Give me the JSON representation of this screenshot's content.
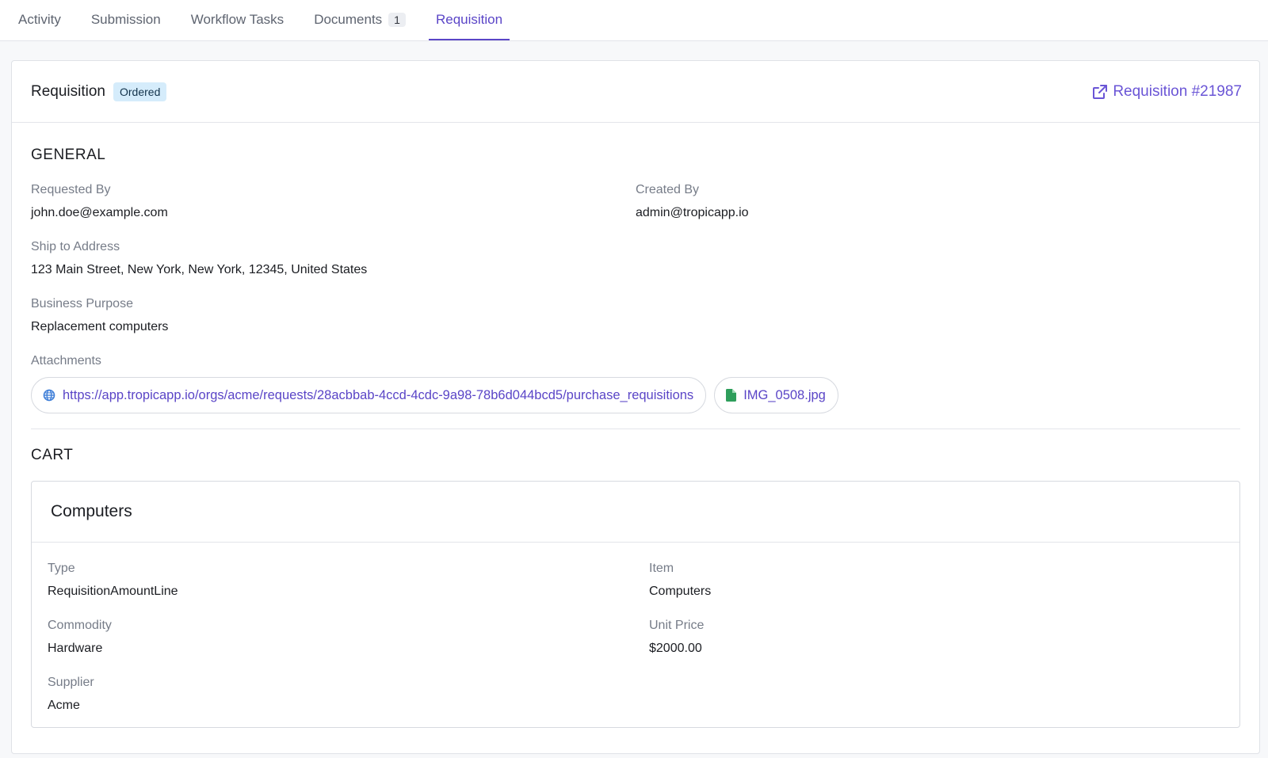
{
  "tabs": [
    {
      "label": "Activity"
    },
    {
      "label": "Submission"
    },
    {
      "label": "Workflow Tasks"
    },
    {
      "label": "Documents",
      "badge": "1"
    },
    {
      "label": "Requisition",
      "active": true
    }
  ],
  "header": {
    "title": "Requisition",
    "status": "Ordered",
    "link_label": "Requisition #21987"
  },
  "general": {
    "title": "GENERAL",
    "requested_by": {
      "label": "Requested By",
      "value": "john.doe@example.com"
    },
    "created_by": {
      "label": "Created By",
      "value": "admin@tropicapp.io"
    },
    "ship_to": {
      "label": "Ship to Address",
      "value": "123 Main Street, New York, New York, 12345, United States"
    },
    "purpose": {
      "label": "Business Purpose",
      "value": "Replacement computers"
    },
    "attachments": {
      "label": "Attachments",
      "items": [
        {
          "label": "https://app.tropicapp.io/orgs/acme/requests/28acbbab-4ccd-4cdc-9a98-78b6d044bcd5/purchase_requisitions",
          "icon": "globe-icon"
        },
        {
          "label": "IMG_0508.jpg",
          "icon": "file-icon"
        }
      ]
    }
  },
  "cart": {
    "title": "CART",
    "item": {
      "name": "Computers",
      "type": {
        "label": "Type",
        "value": "RequisitionAmountLine"
      },
      "item": {
        "label": "Item",
        "value": "Computers"
      },
      "commodity": {
        "label": "Commodity",
        "value": "Hardware"
      },
      "unit_price": {
        "label": "Unit Price",
        "value": "$2000.00"
      },
      "supplier": {
        "label": "Supplier",
        "value": "Acme"
      }
    }
  },
  "colors": {
    "accent": "#5a45c7",
    "badge_bg": "#d5ecfb",
    "file_icon": "#2e9e5b",
    "globe_icon": "#3f7fd8"
  }
}
